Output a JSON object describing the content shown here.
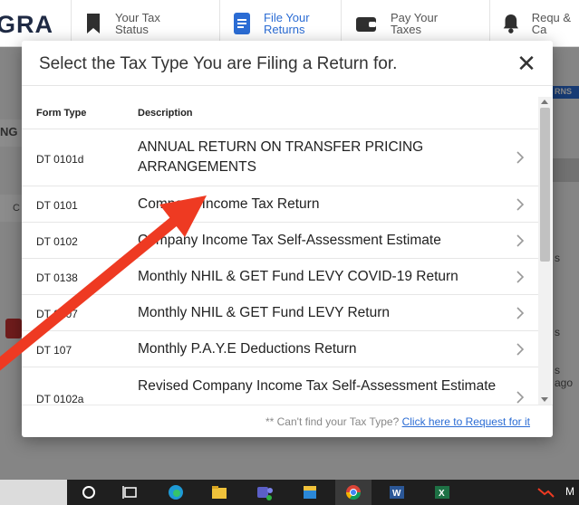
{
  "app": {
    "brand": "GRA",
    "nav": [
      {
        "label": "Your Tax Status",
        "icon": "bookmark-icon",
        "active": false
      },
      {
        "label": "File Your Returns",
        "icon": "document-icon",
        "active": true
      },
      {
        "label": "Pay Your Taxes",
        "icon": "wallet-icon",
        "active": false
      },
      {
        "label": "Requ & Ca",
        "icon": "bell-icon",
        "active": false
      }
    ],
    "background_fragments": {
      "left_ng": "NG",
      "left_c": "C",
      "right_badge": "RNS",
      "right_s1": "s",
      "right_s2": "s",
      "right_ago": "s ago"
    }
  },
  "modal": {
    "title": "Select the Tax Type You are Filing a Return for.",
    "close_glyph": "✕",
    "columns": {
      "form_type": "Form Type",
      "description": "Description"
    },
    "rows": [
      {
        "code": "DT 0101d",
        "description": "ANNUAL RETURN ON TRANSFER PRICING ARRANGEMENTS"
      },
      {
        "code": "DT 0101",
        "description": "Company Income Tax Return"
      },
      {
        "code": "DT 0102",
        "description": "Company Income Tax Self-Assessment Estimate"
      },
      {
        "code": "DT 0138",
        "description": "Monthly NHIL & GET Fund LEVY COVID-19 Return"
      },
      {
        "code": "DT 0107",
        "description": "Monthly NHIL & GET Fund LEVY Return"
      },
      {
        "code": "DT 107",
        "description": "Monthly P.A.Y.E Deductions Return"
      },
      {
        "code": "DT 0102a",
        "description": "Revised Company Income Tax Self-Assessment Estimate"
      }
    ],
    "footer": {
      "prefix": "** Can't find your Tax Type?",
      "link": "Click here to Request for it"
    }
  },
  "taskbar": {
    "icons": [
      "search-circle-icon",
      "task-view-icon",
      "edge-icon",
      "file-explorer-icon",
      "teams-icon",
      "store-icon",
      "chrome-icon",
      "word-icon",
      "excel-icon"
    ],
    "tray_text": "M"
  },
  "colors": {
    "accent": "#2b6cd4",
    "annotation_arrow": "#ee3a22",
    "overlay": "rgba(0,0,0,0.45)"
  }
}
